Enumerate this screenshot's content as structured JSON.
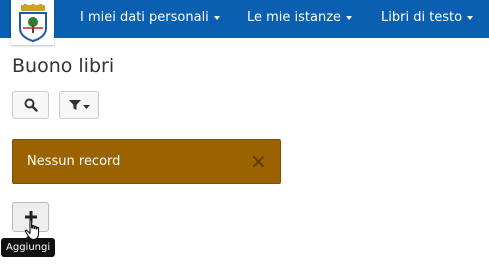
{
  "header": {
    "logo_icon": "coat-of-arms-icon",
    "brand_color": "#0b5fb0",
    "nav": [
      {
        "label": "I miei dati personali"
      },
      {
        "label": "Le mie istanze"
      },
      {
        "label": "Libri di testo"
      }
    ]
  },
  "page": {
    "title": "Buono libri"
  },
  "toolbar": {
    "search_icon": "search-icon",
    "filter_icon": "filter-icon"
  },
  "alert": {
    "message": "Nessun record",
    "color": "#9b6200",
    "close_icon": "close-icon"
  },
  "add": {
    "icon": "plus-icon",
    "tooltip": "Aggiungi"
  }
}
